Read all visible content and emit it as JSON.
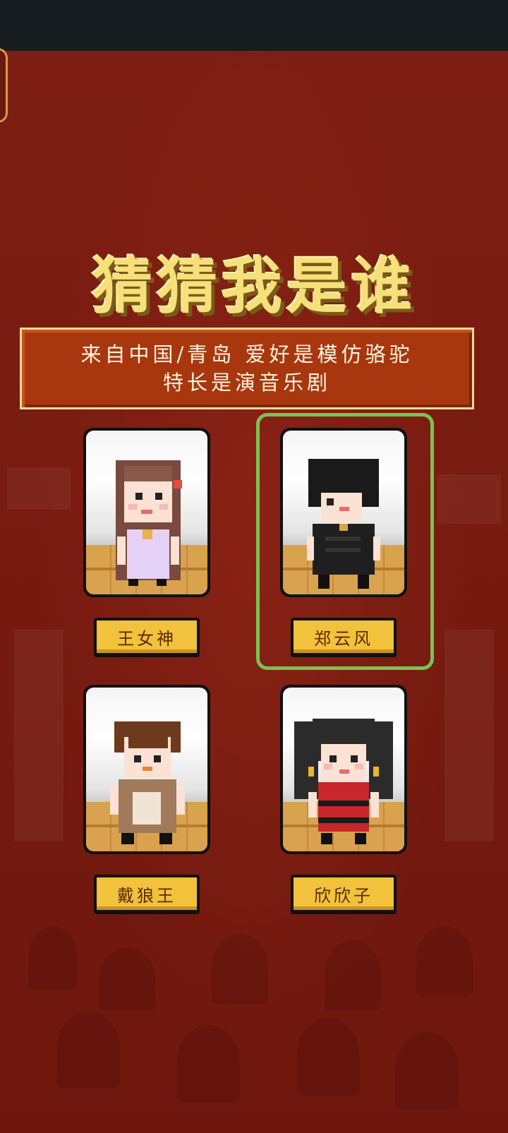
{
  "title": "猜猜我是谁",
  "clue": {
    "line1": "来自中国/青岛 爱好是模仿骆驼",
    "line2": "特长是演音乐剧"
  },
  "choices": [
    {
      "name": "王女神",
      "selected": false
    },
    {
      "name": "郑云风",
      "selected": true
    },
    {
      "name": "戴狼王",
      "selected": false
    },
    {
      "name": "欣欣子",
      "selected": false
    }
  ],
  "colors": {
    "background": "#7a1a10",
    "title": "#f7df7a",
    "clue_box": "#a8370f",
    "name_button": "#f2c23c",
    "selection": "#7bc253"
  }
}
